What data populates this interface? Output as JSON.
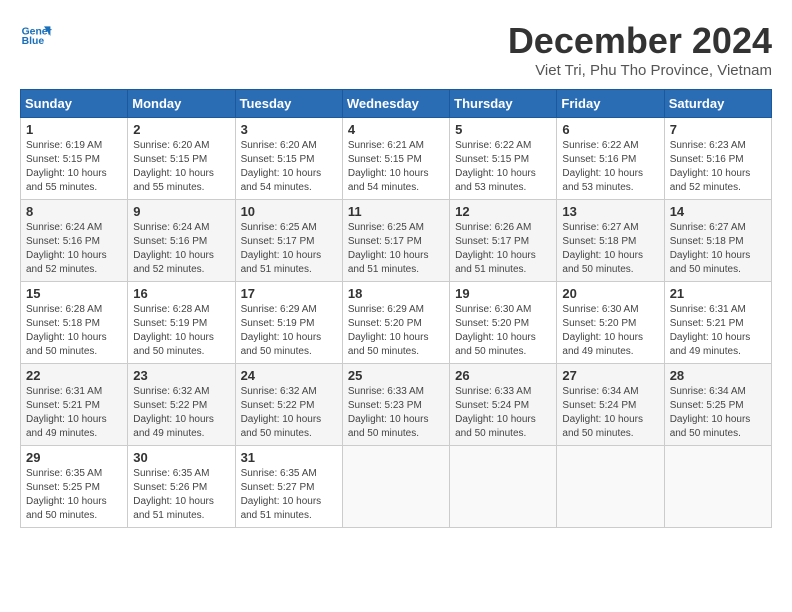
{
  "header": {
    "logo_line1": "General",
    "logo_line2": "Blue",
    "month": "December 2024",
    "location": "Viet Tri, Phu Tho Province, Vietnam"
  },
  "days_of_week": [
    "Sunday",
    "Monday",
    "Tuesday",
    "Wednesday",
    "Thursday",
    "Friday",
    "Saturday"
  ],
  "weeks": [
    [
      {
        "day": "1",
        "info": "Sunrise: 6:19 AM\nSunset: 5:15 PM\nDaylight: 10 hours\nand 55 minutes."
      },
      {
        "day": "2",
        "info": "Sunrise: 6:20 AM\nSunset: 5:15 PM\nDaylight: 10 hours\nand 55 minutes."
      },
      {
        "day": "3",
        "info": "Sunrise: 6:20 AM\nSunset: 5:15 PM\nDaylight: 10 hours\nand 54 minutes."
      },
      {
        "day": "4",
        "info": "Sunrise: 6:21 AM\nSunset: 5:15 PM\nDaylight: 10 hours\nand 54 minutes."
      },
      {
        "day": "5",
        "info": "Sunrise: 6:22 AM\nSunset: 5:15 PM\nDaylight: 10 hours\nand 53 minutes."
      },
      {
        "day": "6",
        "info": "Sunrise: 6:22 AM\nSunset: 5:16 PM\nDaylight: 10 hours\nand 53 minutes."
      },
      {
        "day": "7",
        "info": "Sunrise: 6:23 AM\nSunset: 5:16 PM\nDaylight: 10 hours\nand 52 minutes."
      }
    ],
    [
      {
        "day": "8",
        "info": "Sunrise: 6:24 AM\nSunset: 5:16 PM\nDaylight: 10 hours\nand 52 minutes."
      },
      {
        "day": "9",
        "info": "Sunrise: 6:24 AM\nSunset: 5:16 PM\nDaylight: 10 hours\nand 52 minutes."
      },
      {
        "day": "10",
        "info": "Sunrise: 6:25 AM\nSunset: 5:17 PM\nDaylight: 10 hours\nand 51 minutes."
      },
      {
        "day": "11",
        "info": "Sunrise: 6:25 AM\nSunset: 5:17 PM\nDaylight: 10 hours\nand 51 minutes."
      },
      {
        "day": "12",
        "info": "Sunrise: 6:26 AM\nSunset: 5:17 PM\nDaylight: 10 hours\nand 51 minutes."
      },
      {
        "day": "13",
        "info": "Sunrise: 6:27 AM\nSunset: 5:18 PM\nDaylight: 10 hours\nand 50 minutes."
      },
      {
        "day": "14",
        "info": "Sunrise: 6:27 AM\nSunset: 5:18 PM\nDaylight: 10 hours\nand 50 minutes."
      }
    ],
    [
      {
        "day": "15",
        "info": "Sunrise: 6:28 AM\nSunset: 5:18 PM\nDaylight: 10 hours\nand 50 minutes."
      },
      {
        "day": "16",
        "info": "Sunrise: 6:28 AM\nSunset: 5:19 PM\nDaylight: 10 hours\nand 50 minutes."
      },
      {
        "day": "17",
        "info": "Sunrise: 6:29 AM\nSunset: 5:19 PM\nDaylight: 10 hours\nand 50 minutes."
      },
      {
        "day": "18",
        "info": "Sunrise: 6:29 AM\nSunset: 5:20 PM\nDaylight: 10 hours\nand 50 minutes."
      },
      {
        "day": "19",
        "info": "Sunrise: 6:30 AM\nSunset: 5:20 PM\nDaylight: 10 hours\nand 50 minutes."
      },
      {
        "day": "20",
        "info": "Sunrise: 6:30 AM\nSunset: 5:20 PM\nDaylight: 10 hours\nand 49 minutes."
      },
      {
        "day": "21",
        "info": "Sunrise: 6:31 AM\nSunset: 5:21 PM\nDaylight: 10 hours\nand 49 minutes."
      }
    ],
    [
      {
        "day": "22",
        "info": "Sunrise: 6:31 AM\nSunset: 5:21 PM\nDaylight: 10 hours\nand 49 minutes."
      },
      {
        "day": "23",
        "info": "Sunrise: 6:32 AM\nSunset: 5:22 PM\nDaylight: 10 hours\nand 49 minutes."
      },
      {
        "day": "24",
        "info": "Sunrise: 6:32 AM\nSunset: 5:22 PM\nDaylight: 10 hours\nand 50 minutes."
      },
      {
        "day": "25",
        "info": "Sunrise: 6:33 AM\nSunset: 5:23 PM\nDaylight: 10 hours\nand 50 minutes."
      },
      {
        "day": "26",
        "info": "Sunrise: 6:33 AM\nSunset: 5:24 PM\nDaylight: 10 hours\nand 50 minutes."
      },
      {
        "day": "27",
        "info": "Sunrise: 6:34 AM\nSunset: 5:24 PM\nDaylight: 10 hours\nand 50 minutes."
      },
      {
        "day": "28",
        "info": "Sunrise: 6:34 AM\nSunset: 5:25 PM\nDaylight: 10 hours\nand 50 minutes."
      }
    ],
    [
      {
        "day": "29",
        "info": "Sunrise: 6:35 AM\nSunset: 5:25 PM\nDaylight: 10 hours\nand 50 minutes."
      },
      {
        "day": "30",
        "info": "Sunrise: 6:35 AM\nSunset: 5:26 PM\nDaylight: 10 hours\nand 51 minutes."
      },
      {
        "day": "31",
        "info": "Sunrise: 6:35 AM\nSunset: 5:27 PM\nDaylight: 10 hours\nand 51 minutes."
      },
      {
        "day": "",
        "info": ""
      },
      {
        "day": "",
        "info": ""
      },
      {
        "day": "",
        "info": ""
      },
      {
        "day": "",
        "info": ""
      }
    ]
  ]
}
